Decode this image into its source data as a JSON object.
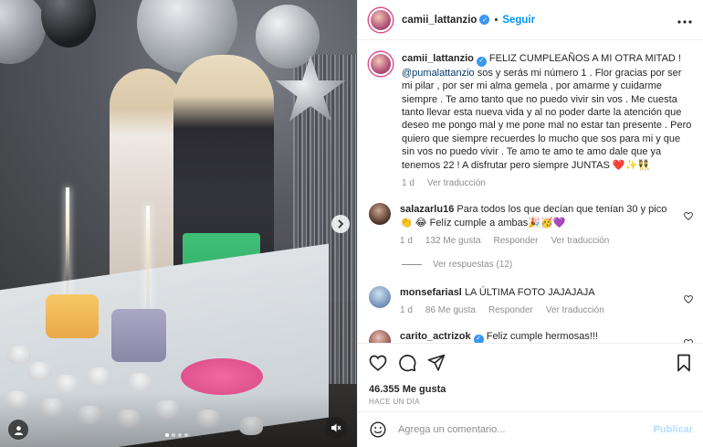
{
  "post": {
    "username": "camii_lattanzio",
    "follow_label": "Seguir",
    "more_icon": "more-horizontal-icon",
    "verified_icon": "verified-badge-icon"
  },
  "caption": {
    "username": "camii_lattanzio",
    "text_1": "FELIZ CUMPLEAÑOS A MI OTRA MITAD !",
    "mention": "@pumalattanzio",
    "text_2": " sos y serás mi número 1 . Flor gracias por ser mi pilar , por ser mi alma gemela , por amarme y cuidarme siempre . Te amo tanto que no puedo vivir sin vos . Me cuesta tanto llevar esta nueva vida y al no poder darte la atención que deseo me pongo mal y me pone mal no estar tan presente . Pero quiero que siempre recuerdes lo mucho que sos para mi y que sin vos no puedo vivir . Te amo te amo te amo dale que ya tenemos 22 ! A disfrutar pero siempre JUNTAS ❤️✨👯",
    "age": "1 d",
    "translate_label": "Ver traducción"
  },
  "comments": [
    {
      "username": "salazarlu16",
      "text": "Para todos los que decían que tenían 30 y pico👏 😂 Felíz cumple a ambas🎉🥳💜",
      "age": "1 d",
      "likes": "132 Me gusta",
      "reply_label": "Responder",
      "translate_label": "Ver traducción",
      "view_replies": "Ver respuestas (12)"
    },
    {
      "username": "monsefariasl",
      "text": "LA ÚLTIMA FOTO JAJAJAJA",
      "age": "1 d",
      "likes": "86 Me gusta",
      "reply_label": "Responder",
      "translate_label": "Ver traducción"
    },
    {
      "username": "carito_actrizok",
      "text": "Feliz cumple hermosas!!!"
    }
  ],
  "actions": {
    "like_icon": "heart-icon",
    "comment_icon": "comment-icon",
    "share_icon": "share-icon",
    "save_icon": "bookmark-icon",
    "likes_count": "46.355 Me gusta",
    "time_ago": "HACE UN DÍA"
  },
  "composer": {
    "emoji_icon": "emoji-icon",
    "placeholder": "Agrega un comentario...",
    "publish_label": "Publicar"
  },
  "media": {
    "next_icon": "chevron-right-icon",
    "user_tag_icon": "user-tag-icon",
    "mute_icon": "mute-icon",
    "carousel_total": 4,
    "carousel_active": 1
  }
}
